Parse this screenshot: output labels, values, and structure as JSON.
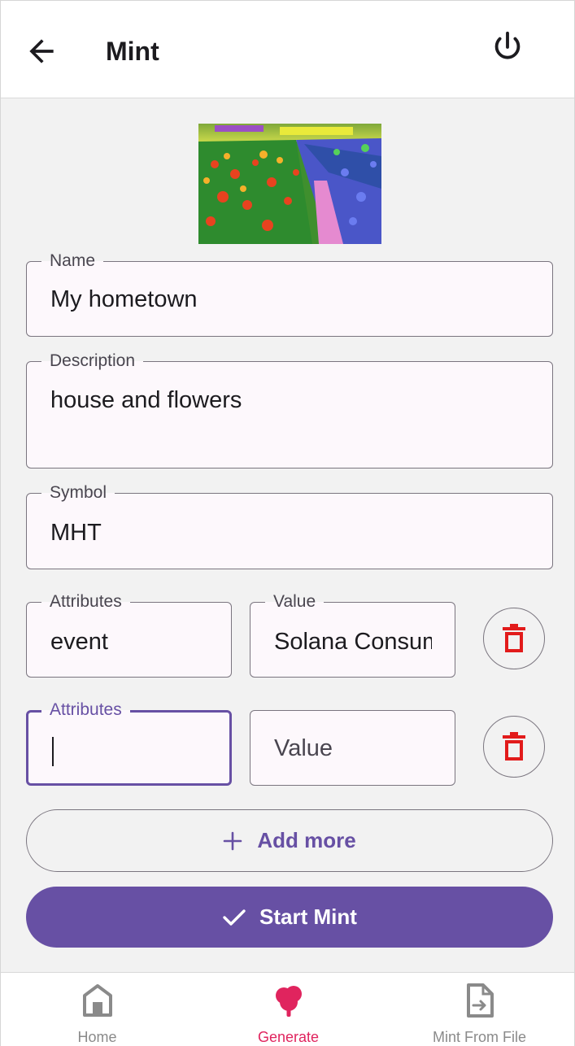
{
  "appbar": {
    "title": "Mint",
    "back_icon": "arrow-left-icon",
    "power_icon": "power-icon"
  },
  "form": {
    "name": {
      "label": "Name",
      "value": "My hometown"
    },
    "description": {
      "label": "Description",
      "value": "house and flowers"
    },
    "symbol": {
      "label": "Symbol",
      "value": "MHT"
    },
    "attributes": [
      {
        "attr_label": "Attributes",
        "attr_value": "event",
        "value_label": "Value",
        "value_value": "Solana Consum"
      },
      {
        "attr_label": "Attributes",
        "attr_value": "",
        "value_placeholder": "Value"
      }
    ]
  },
  "buttons": {
    "add_more": "Add more",
    "start_mint": "Start Mint"
  },
  "bottom_nav": {
    "items": [
      {
        "label": "Home",
        "icon": "home-icon",
        "active": false
      },
      {
        "label": "Generate",
        "icon": "tree-icon",
        "active": true
      },
      {
        "label": "Mint From File",
        "icon": "file-export-icon",
        "active": false
      }
    ]
  },
  "colors": {
    "accent": "#6750a4",
    "active_nav": "#e0245e",
    "delete_icon": "#e21b1b"
  }
}
